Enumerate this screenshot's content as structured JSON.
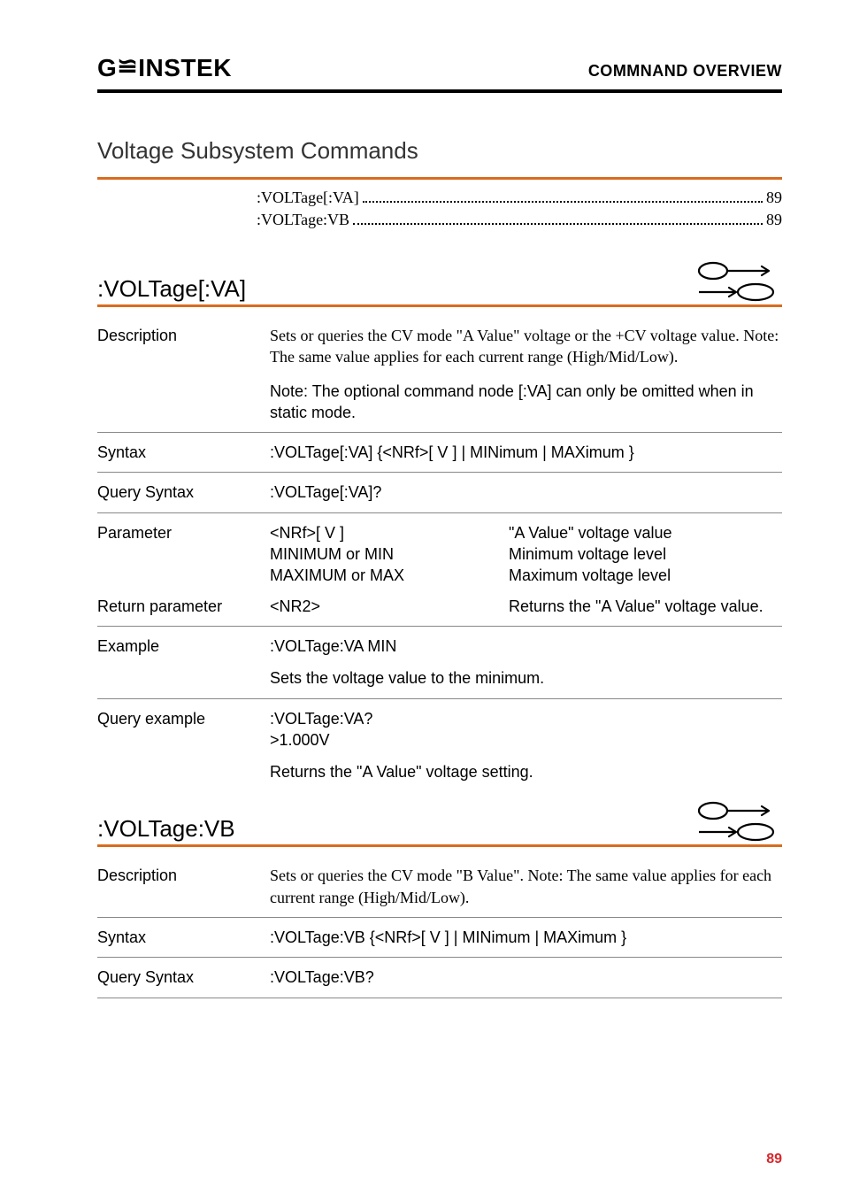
{
  "header": {
    "logo_prefix": "G",
    "logo_accent": "≌",
    "logo_suffix": "INSTEK",
    "title": "COMMNAND OVERVIEW"
  },
  "section_title": "Voltage Subsystem Commands",
  "toc": [
    {
      "label": ":VOLTage[:VA]",
      "page": "89"
    },
    {
      "label": ":VOLTage:VB",
      "page": "89"
    }
  ],
  "cmd_va": {
    "name": ":VOLTage[:VA]",
    "desc_label": "Description",
    "desc_text": "Sets or queries the CV mode \"A Value\" voltage or the +CV voltage value. Note: The same value applies for each current range (High/Mid/Low).",
    "note_text": "Note: The optional command node [:VA] can only be omitted when in static mode.",
    "syntax_label": "Syntax",
    "syntax_text": ":VOLTage[:VA] {<NRf>[ V ] | MINimum | MAXimum }",
    "qsyntax_label": "Query Syntax",
    "qsyntax_text": ":VOLTage[:VA]?",
    "param_label": "Parameter",
    "param_l1": "<NRf>[ V ]",
    "param_l2": "MINIMUM or MIN",
    "param_l3": "MAXIMUM or MAX",
    "param_r1": "\"A Value\" voltage value",
    "param_r2": "Minimum voltage level",
    "param_r3": "Maximum voltage level",
    "ret_label": "Return parameter",
    "ret_left": "<NR2>",
    "ret_right": "Returns the \"A Value\" voltage value.",
    "ex_label": "Example",
    "ex_text": ":VOLTage:VA MIN",
    "ex_sub": "Sets the voltage value to the minimum.",
    "qex_label": "Query example",
    "qex_line1": ":VOLTage:VA?",
    "qex_line2": ">1.000V",
    "qex_sub": "Returns the \"A Value\" voltage setting."
  },
  "cmd_vb": {
    "name": ":VOLTage:VB",
    "desc_label": "Description",
    "desc_text": "Sets or queries the CV mode \"B Value\". Note: The same value applies for each current range (High/Mid/Low).",
    "syntax_label": "Syntax",
    "syntax_text": ":VOLTage:VB {<NRf>[ V ] | MINimum | MAXimum }",
    "qsyntax_label": "Query Syntax",
    "qsyntax_text": ":VOLTage:VB?"
  },
  "page_number": "89"
}
